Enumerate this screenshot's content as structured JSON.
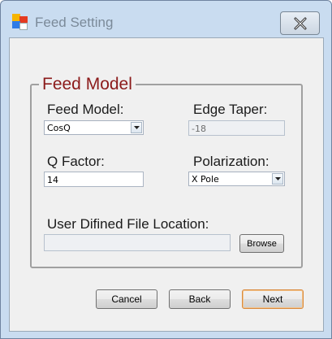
{
  "window": {
    "title": "Feed Setting"
  },
  "group": {
    "title": "Feed Model"
  },
  "feed_model": {
    "label": "Feed Model:",
    "value": "CosQ"
  },
  "edge_taper": {
    "label": "Edge Taper:",
    "value": "-18"
  },
  "q_factor": {
    "label": "Q Factor:",
    "value": "14"
  },
  "polarization": {
    "label": "Polarization:",
    "value": "X Pole"
  },
  "file_location": {
    "label": "User Difined File Location:",
    "value": "",
    "browse_label": "Browse"
  },
  "buttons": {
    "cancel": "Cancel",
    "back": "Back",
    "next": "Next"
  },
  "colors": {
    "group_title": "#8b1a1a",
    "window_frame": "#c9dcf0",
    "default_button_border": "#d98a3d"
  },
  "icons": [
    "app-icon",
    "close-icon",
    "chevron-down-icon"
  ]
}
